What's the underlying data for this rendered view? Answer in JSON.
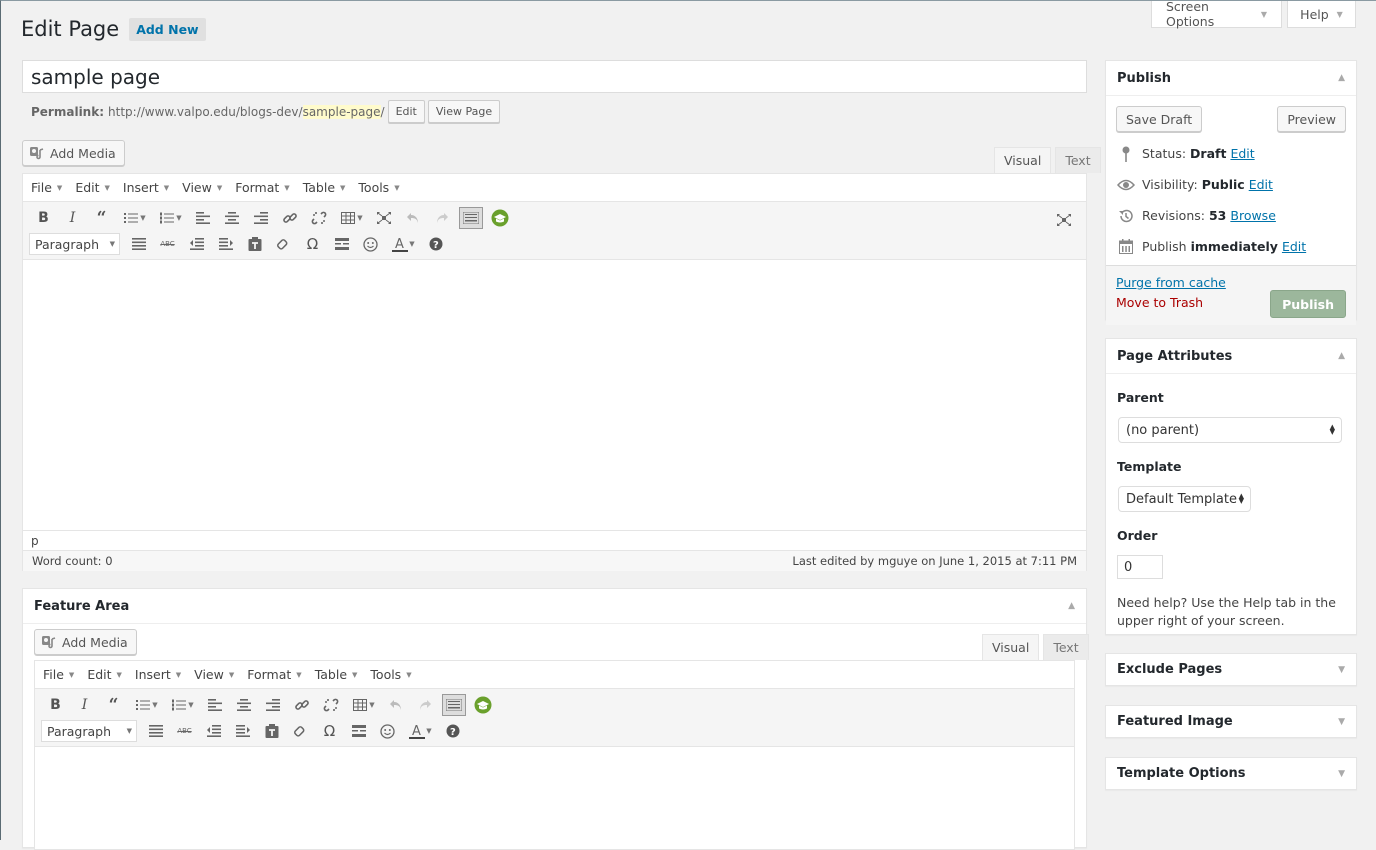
{
  "screen_meta": {
    "screen_options": "Screen Options",
    "help": "Help"
  },
  "header": {
    "title": "Edit Page",
    "add_new": "Add New"
  },
  "post": {
    "title_value": "sample page",
    "permalink_label": "Permalink:",
    "permalink_base": "http://www.valpo.edu/blogs-dev/",
    "permalink_slug": "sample-page",
    "permalink_trailing": "/",
    "edit_button": "Edit",
    "view_button": "View Page"
  },
  "main_editor": {
    "add_media": "Add Media",
    "tabs": [
      {
        "label": "Visual",
        "active": true
      },
      {
        "label": "Text",
        "active": false
      }
    ],
    "menu": [
      "File",
      "Edit",
      "Insert",
      "View",
      "Format",
      "Table",
      "Tools"
    ],
    "toolbar_row1": [
      "bold-icon",
      "italic-icon",
      "blockquote-icon",
      "bullet-list-icon",
      "numbered-list-icon",
      "align-left-icon",
      "align-center-icon",
      "align-right-icon",
      "link-icon",
      "unlink-icon",
      "table-icon",
      "fullscreen-icon",
      "undo-icon",
      "redo-icon",
      "toolbar-toggle-icon",
      "mortarboard-icon"
    ],
    "format_select": "Paragraph",
    "toolbar_row2": [
      "justify-icon",
      "strikethrough-icon",
      "outdent-icon",
      "indent-icon",
      "paste-text-icon",
      "clear-formatting-icon",
      "special-char-icon",
      "horizontal-rule-icon",
      "emoticon-icon",
      "text-color-icon",
      "help-icon"
    ],
    "path": "p",
    "word_count": "Word count: 0",
    "last_edited": "Last edited by mguye on June 1, 2015 at 7:11 PM"
  },
  "feature_area": {
    "title": "Feature Area",
    "add_media": "Add Media",
    "tabs": [
      {
        "label": "Visual",
        "active": true
      },
      {
        "label": "Text",
        "active": false
      }
    ],
    "menu": [
      "File",
      "Edit",
      "Insert",
      "View",
      "Format",
      "Table",
      "Tools"
    ],
    "format_select": "Paragraph"
  },
  "publish": {
    "title": "Publish",
    "save_draft": "Save Draft",
    "preview": "Preview",
    "status_label": "Status:",
    "status_value": "Draft",
    "visibility_label": "Visibility:",
    "visibility_value": "Public",
    "revisions_label": "Revisions:",
    "revisions_value": "53",
    "browse": "Browse",
    "publish_label": "Publish",
    "publish_value": "immediately",
    "edit": "Edit",
    "purge": "Purge from cache",
    "trash": "Move to Trash",
    "publish_button": "Publish"
  },
  "page_attributes": {
    "title": "Page Attributes",
    "parent_label": "Parent",
    "parent_value": "(no parent)",
    "template_label": "Template",
    "template_value": "Default Template",
    "order_label": "Order",
    "order_value": "0",
    "help_text": "Need help? Use the Help tab in the upper right of your screen."
  },
  "sidebar_boxes": [
    {
      "title": "Exclude Pages"
    },
    {
      "title": "Featured Image"
    },
    {
      "title": "Template Options"
    }
  ],
  "colors": {
    "link": "#0073aa",
    "trash": "#aa0000",
    "publish_button": "#9cb79c",
    "permalink_highlight": "#fffbcc",
    "background": "#f1f1f1"
  }
}
